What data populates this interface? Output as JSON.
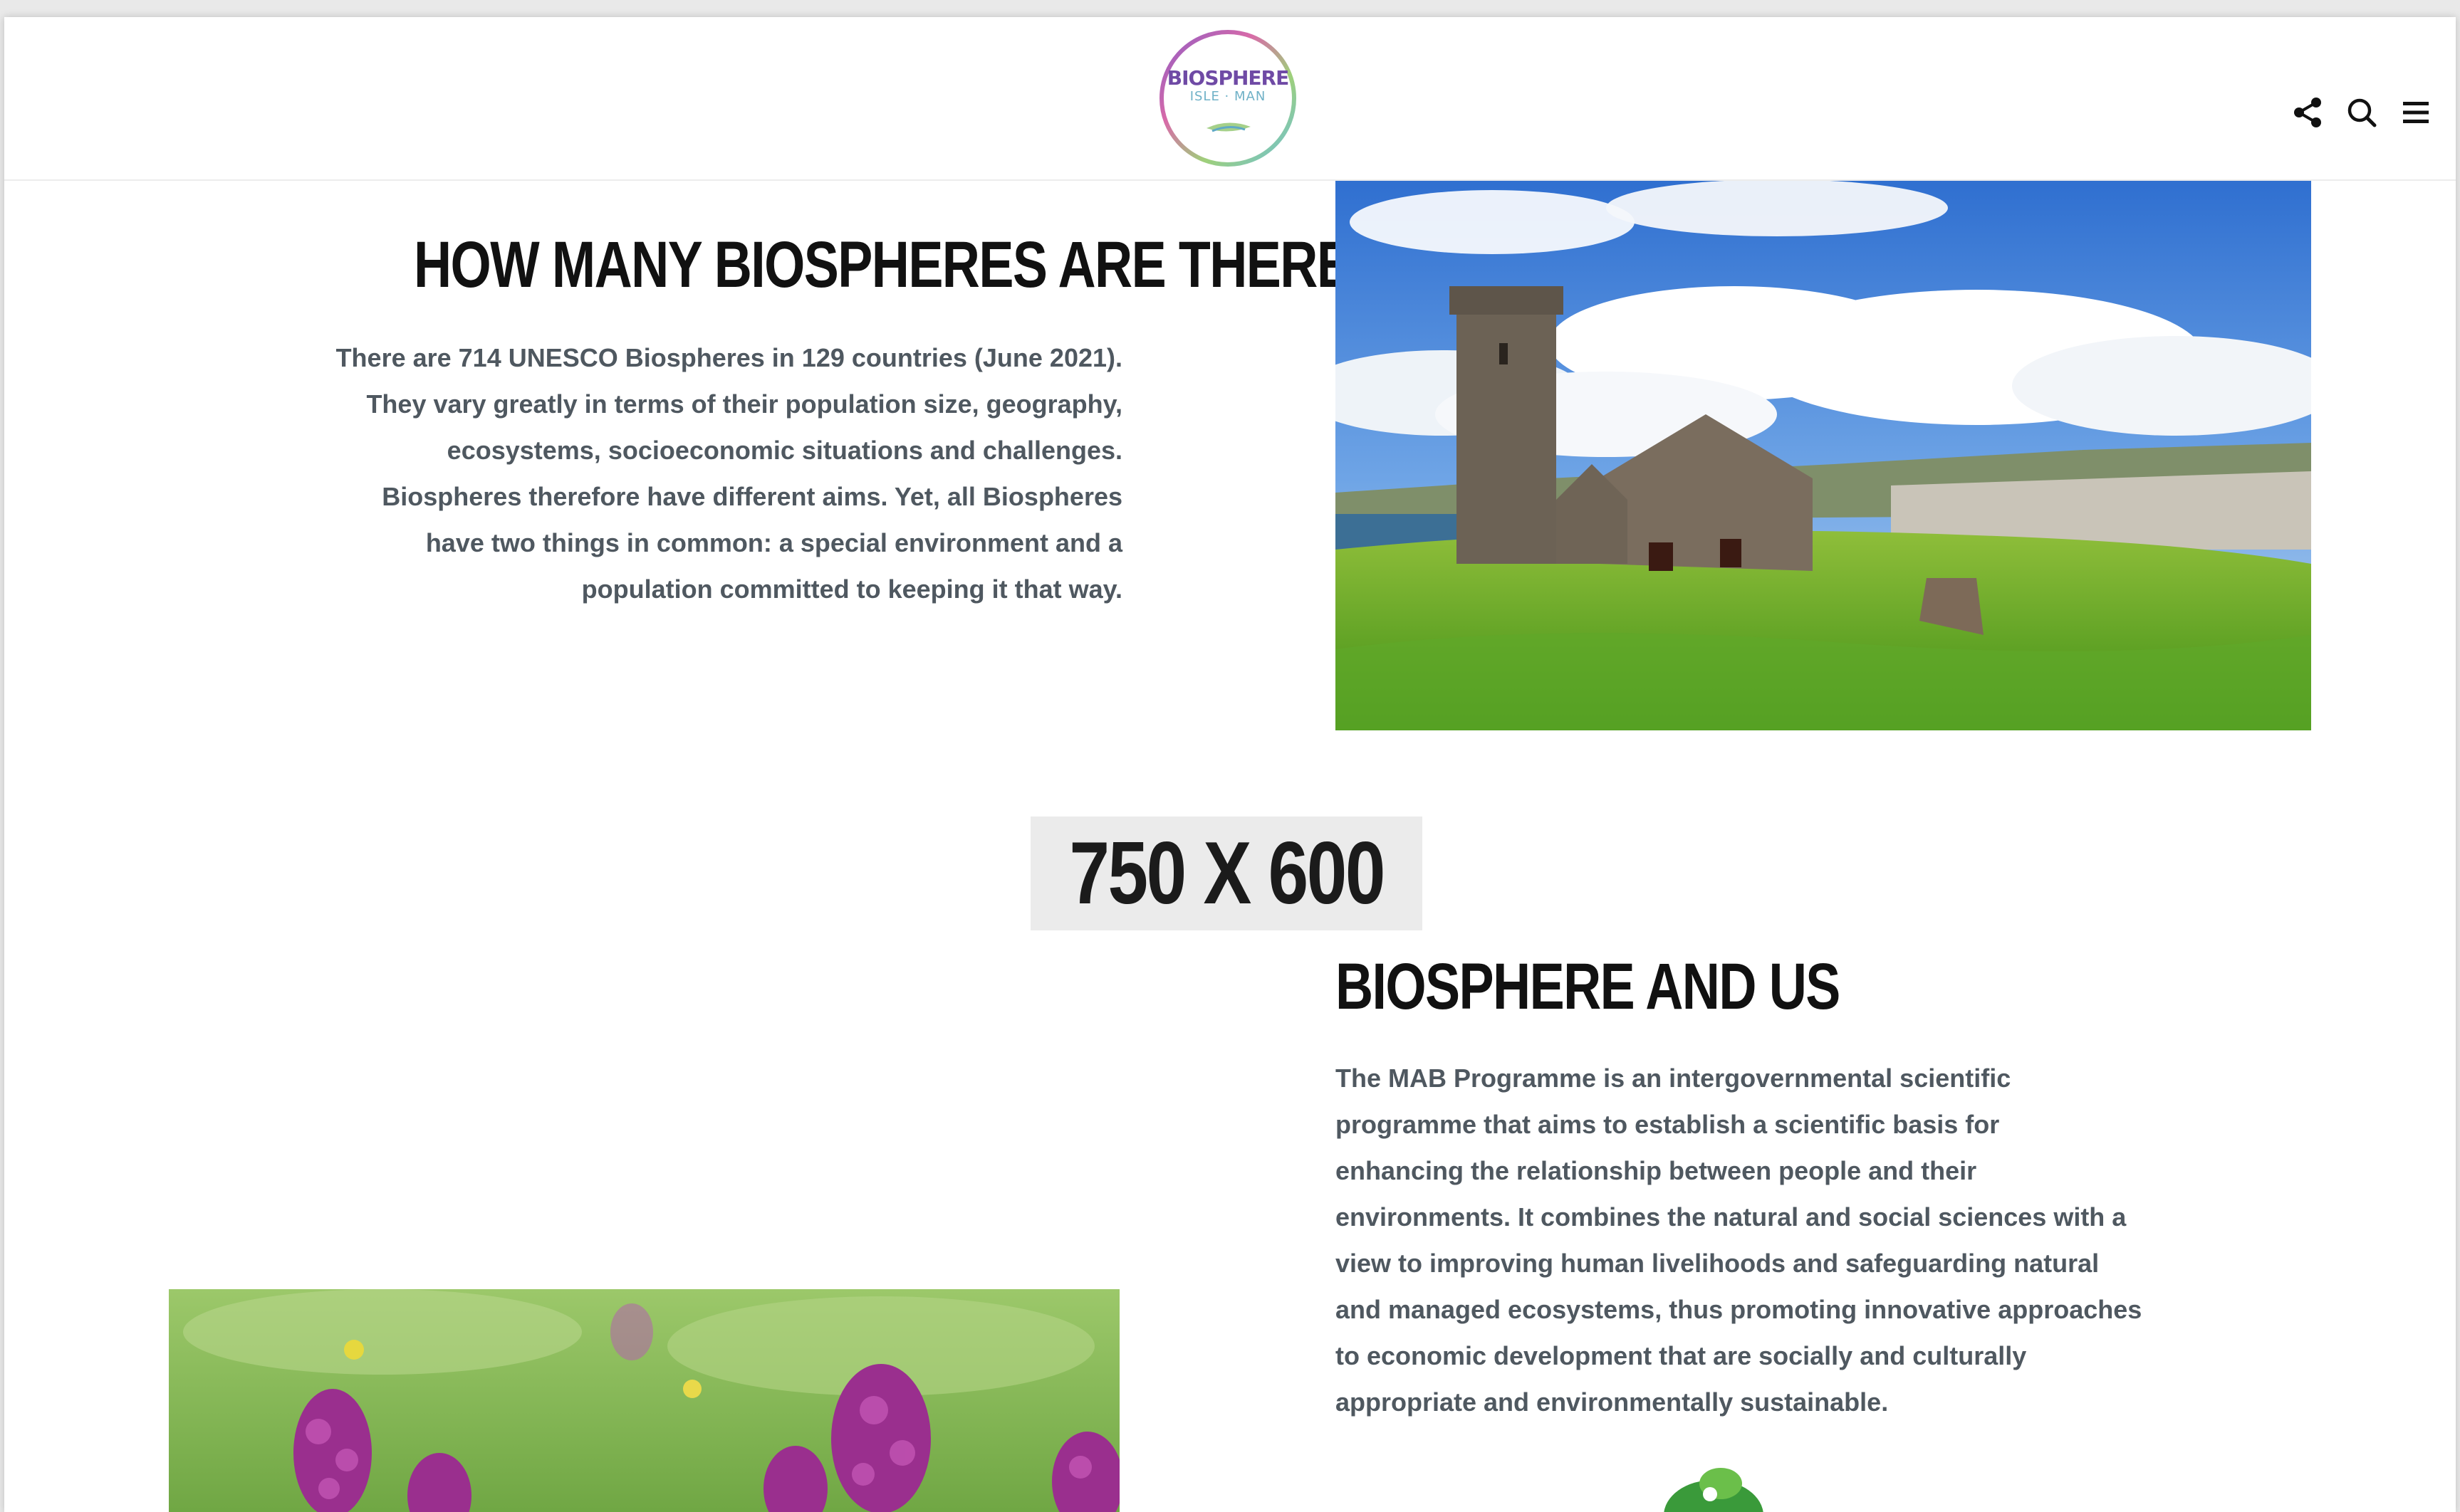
{
  "header": {
    "logo_line1": "BIOSPHERE",
    "logo_line2": "ISLE · MAN",
    "share_icon": "share-icon",
    "search_icon": "search-icon",
    "menu_icon": "hamburger-menu-icon"
  },
  "section1": {
    "heading": "HOW MANY BIOSPHERES ARE THERE?",
    "lines": [
      "There are 714 UNESCO Biospheres in 129 countries (June 2021).",
      "They vary greatly in terms of their population size, geography,",
      "ecosystems, socioeconomic situations and challenges.",
      "Biospheres therefore have different aims. Yet, all Biospheres",
      "have two things in common: a special environment and a",
      "population committed to keeping it that way."
    ],
    "image": "photo of a round stone tower and ruined stone church on green grass under a blue cloudy sky"
  },
  "placeholder": {
    "label": "750 X 600"
  },
  "section2": {
    "heading": "BIOSPHERE AND US",
    "lines": [
      "The MAB Programme is an intergovernmental scientific",
      "programme that aims to establish a scientific basis for",
      "enhancing the relationship between people and their",
      "environments. It combines the natural and social sciences with a",
      "view to improving human livelihoods and safeguarding natural",
      "and managed ecosystems, thus promoting innovative approaches",
      "to economic development that are socially and culturally",
      "appropriate and environmentally sustainable."
    ],
    "image": "photo of purple orchid flowers in a green meadow"
  },
  "colors": {
    "heading": "#111111",
    "body_text": "#4f5860",
    "placeholder_bg": "#ebebeb",
    "logo_purple": "#6f4aa5",
    "logo_teal": "#6fb1c7"
  }
}
